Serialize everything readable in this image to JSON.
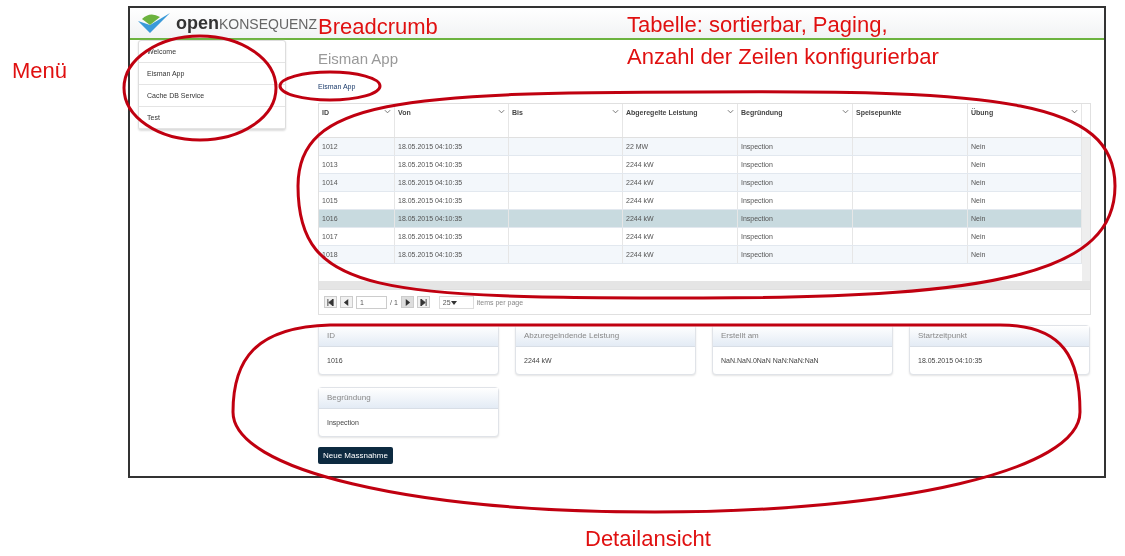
{
  "annotations": [
    {
      "text": "Menü"
    },
    {
      "text": "Breadcrumb"
    },
    {
      "text": "Tabelle: sortierbar, Paging,"
    },
    {
      "text": "Anzahl der Zeilen konfigurierbar"
    },
    {
      "text": "Detailansicht"
    }
  ],
  "app": {
    "logo": {
      "prefix": "open",
      "suffix": "KONSEQUENZ"
    },
    "menu": [
      {
        "label": "Welcome"
      },
      {
        "label": "Eisman App"
      },
      {
        "label": "Cache DB Service"
      },
      {
        "label": "Test"
      }
    ],
    "page_title": "Eisman App",
    "breadcrumb": [
      "Eisman App"
    ],
    "table": {
      "columns": [
        {
          "label": "ID",
          "sortable": true
        },
        {
          "label": "Von",
          "sortable": true
        },
        {
          "label": "Bis",
          "sortable": true
        },
        {
          "label": "Abgeregelte Leistung",
          "sortable": true
        },
        {
          "label": "Begründung",
          "sortable": true
        },
        {
          "label": "Speisepunkte",
          "sortable": false
        },
        {
          "label": "Übung",
          "sortable": true
        }
      ],
      "rows": [
        {
          "selected": false,
          "cells": [
            "1012",
            "18.05.2015 04:10:35",
            "",
            "22 MW",
            "Inspection",
            "",
            "Nein"
          ]
        },
        {
          "selected": false,
          "cells": [
            "1013",
            "18.05.2015 04:10:35",
            "",
            "2244 kW",
            "Inspection",
            "",
            "Nein"
          ]
        },
        {
          "selected": false,
          "cells": [
            "1014",
            "18.05.2015 04:10:35",
            "",
            "2244 kW",
            "Inspection",
            "",
            "Nein"
          ]
        },
        {
          "selected": false,
          "cells": [
            "1015",
            "18.05.2015 04:10:35",
            "",
            "2244 kW",
            "Inspection",
            "",
            "Nein"
          ]
        },
        {
          "selected": true,
          "cells": [
            "1016",
            "18.05.2015 04:10:35",
            "",
            "2244 kW",
            "Inspection",
            "",
            "Nein"
          ]
        },
        {
          "selected": false,
          "cells": [
            "1017",
            "18.05.2015 04:10:35",
            "",
            "2244 kW",
            "Inspection",
            "",
            "Nein"
          ]
        },
        {
          "selected": false,
          "cells": [
            "1018",
            "18.05.2015 04:10:35",
            "",
            "2244 kW",
            "Inspection",
            "",
            "Nein"
          ]
        }
      ]
    },
    "pager": {
      "page": "1",
      "total": "/ 1",
      "page_size": "25",
      "page_size_label": "items per page"
    },
    "details": [
      {
        "label": "ID",
        "value": "1016"
      },
      {
        "label": "Abzuregelndende Leistung",
        "value": "2244 kW"
      },
      {
        "label": "Erstellt am",
        "value": "NaN.NaN.0NaN NaN:NaN:NaN"
      },
      {
        "label": "Startzeitpunkt",
        "value": "18.05.2015 04:10:35"
      },
      {
        "label": "Begründung",
        "value": "Inspection"
      }
    ],
    "button": "Neue Massnahme"
  }
}
